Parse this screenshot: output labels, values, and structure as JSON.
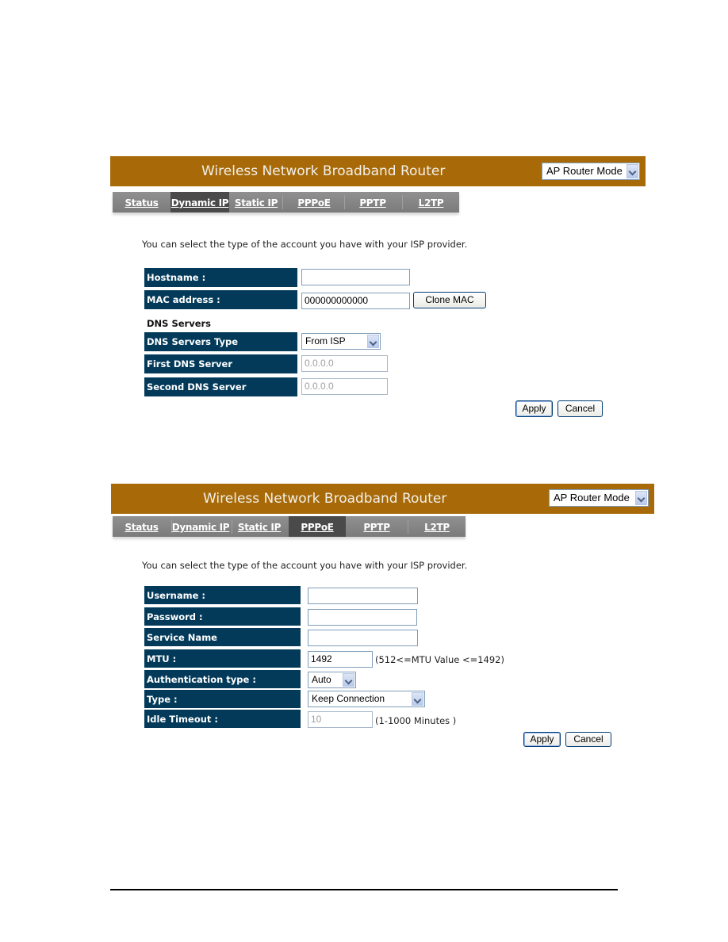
{
  "panels": [
    {
      "banner": {
        "title": "Wireless Network Broadband Router",
        "mode": "AP Router Mode"
      },
      "tabs": [
        {
          "label": "Status",
          "active": false
        },
        {
          "label": "Dynamic IP",
          "active": true
        },
        {
          "label": "Static IP",
          "active": false
        },
        {
          "label": "PPPoE",
          "active": false
        },
        {
          "label": "PPTP",
          "active": false
        },
        {
          "label": "L2TP",
          "active": false
        }
      ],
      "intro": "You can select the type of the account you have with your ISP provider.",
      "fields": {
        "hostname": {
          "label": "Hostname :",
          "value": ""
        },
        "mac": {
          "label": "MAC address :",
          "value": "000000000000",
          "button": "Clone MAC"
        },
        "dns_section": "DNS Servers",
        "dns_type": {
          "label": "DNS Servers Type",
          "value": "From ISP"
        },
        "dns1": {
          "label": "First DNS Server",
          "value": "0.0.0.0"
        },
        "dns2": {
          "label": "Second DNS Server",
          "value": "0.0.0.0"
        }
      },
      "apply": "Apply",
      "cancel": "Cancel"
    },
    {
      "banner": {
        "title": "Wireless Network Broadband Router",
        "mode": "AP Router Mode"
      },
      "tabs": [
        {
          "label": "Status",
          "active": false
        },
        {
          "label": "Dynamic IP",
          "active": false
        },
        {
          "label": "Static IP",
          "active": false
        },
        {
          "label": "PPPoE",
          "active": true
        },
        {
          "label": "PPTP",
          "active": false
        },
        {
          "label": "L2TP",
          "active": false
        }
      ],
      "intro": "You can select the type of the account you have with your ISP provider.",
      "fields": {
        "username": {
          "label": "Username :",
          "value": ""
        },
        "password": {
          "label": "Password :",
          "value": ""
        },
        "service": {
          "label": "Service Name",
          "value": ""
        },
        "mtu": {
          "label": "MTU :",
          "value": "1492",
          "hint": "(512<=MTU Value <=1492)"
        },
        "auth": {
          "label": "Authentication type :",
          "value": "Auto"
        },
        "type": {
          "label": "Type :",
          "value": "Keep Connection"
        },
        "idle": {
          "label": "Idle Timeout :",
          "value": "10",
          "hint": "(1-1000 Minutes )"
        }
      },
      "apply": "Apply",
      "cancel": "Cancel"
    }
  ]
}
